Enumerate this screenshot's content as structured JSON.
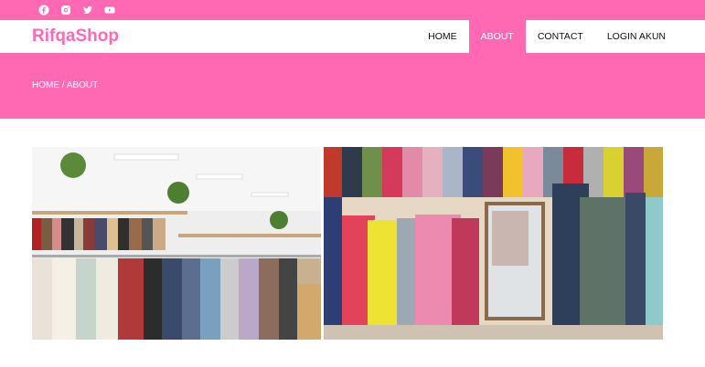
{
  "social": [
    {
      "icon": "facebook-icon"
    },
    {
      "icon": "instagram-icon"
    },
    {
      "icon": "twitter-icon"
    },
    {
      "icon": "youtube-icon"
    }
  ],
  "navbar": {
    "brand": "RifqaShop",
    "items": [
      {
        "label": "HOME"
      },
      {
        "label": "ABOUT",
        "active": true
      },
      {
        "label": "CONTACT"
      },
      {
        "label": "LOGIN AKUN"
      }
    ]
  },
  "banner": {
    "breadcrumb": "HOME / ABOUT"
  },
  "colors": {
    "accent": "#ff69b4",
    "background": "#ffffff",
    "text": "#111111"
  }
}
